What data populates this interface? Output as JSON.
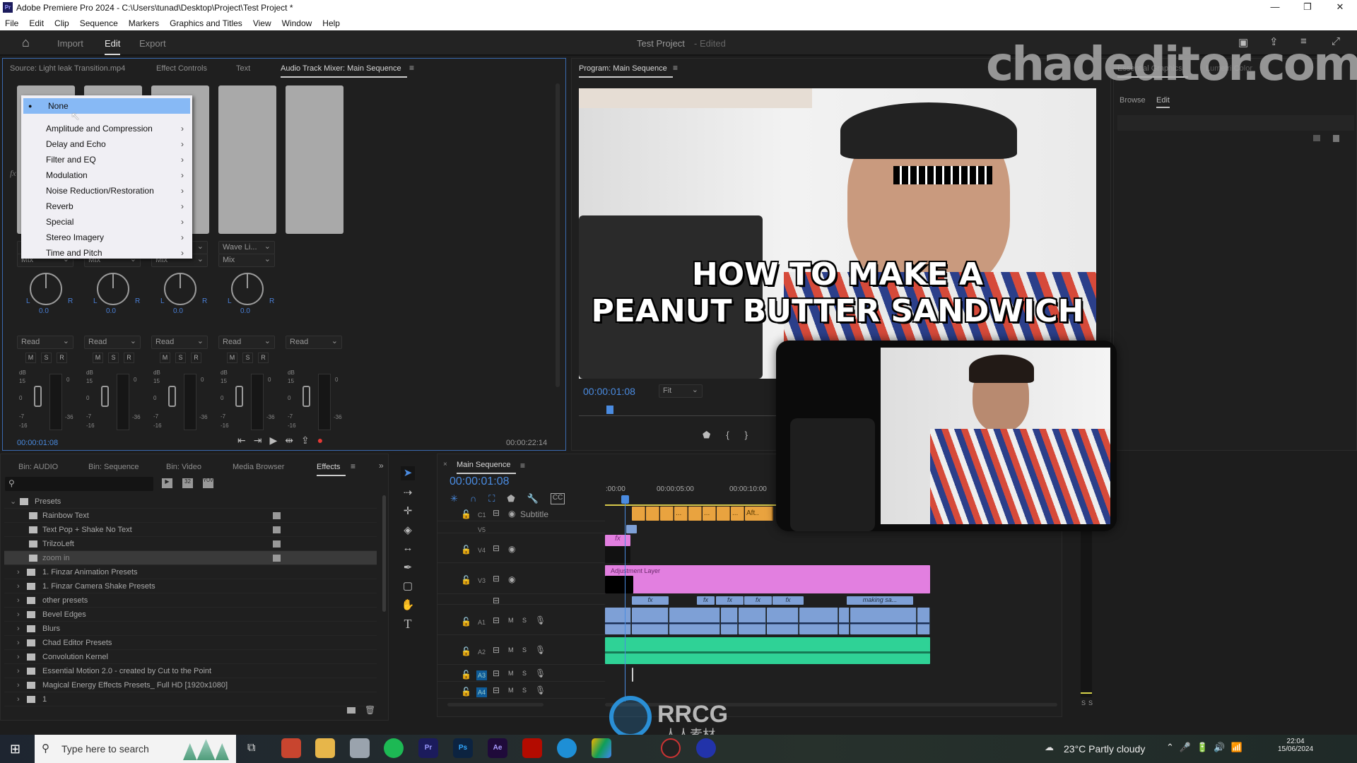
{
  "window": {
    "title": "Adobe Premiere Pro 2024 - C:\\Users\\tunad\\Desktop\\Project\\Test Project *",
    "app_icon": "Pr"
  },
  "menubar": [
    "File",
    "Edit",
    "Clip",
    "Sequence",
    "Markers",
    "Graphics and Titles",
    "View",
    "Window",
    "Help"
  ],
  "header": {
    "nav": [
      "Import",
      "Edit",
      "Export"
    ],
    "active": "Edit",
    "project": "Test Project",
    "status": "- Edited"
  },
  "source_panel": {
    "tabs": [
      "Source: Light leak Transition.mp4",
      "Effect Controls",
      "Text",
      "Audio Track Mixer: Main Sequence"
    ],
    "active_tab": "Audio Track Mixer: Main Sequence",
    "channels": [
      {
        "effect": "",
        "send": "Mix",
        "pan": "0.0",
        "mode": "Read"
      },
      {
        "effect": "",
        "send": "Mix",
        "pan": "0.0",
        "mode": "Read"
      },
      {
        "effect": "",
        "send": "Mix",
        "pan": "0.0",
        "mode": "Read"
      },
      {
        "effect": "Wave Li...",
        "send": "Mix",
        "pan": "0.0",
        "mode": "Read"
      },
      {
        "mode": "Read"
      }
    ],
    "msr": [
      "M",
      "S",
      "R"
    ],
    "pan_l": "L",
    "pan_r": "R",
    "db_scale": [
      "dB",
      "15",
      "0",
      "-7",
      "-16"
    ],
    "meter_scale": [
      "0",
      "-36"
    ],
    "timecode_left": "00:00:01:08",
    "timecode_right": "00:00:22:14"
  },
  "effect_menu": {
    "items": [
      {
        "label": "None",
        "selected": true
      },
      {
        "label": "Amplitude and Compression",
        "submenu": true
      },
      {
        "label": "Delay and Echo",
        "submenu": true
      },
      {
        "label": "Filter and EQ",
        "submenu": true
      },
      {
        "label": "Modulation",
        "submenu": true
      },
      {
        "label": "Noise Reduction/Restoration",
        "submenu": true
      },
      {
        "label": "Reverb",
        "submenu": true
      },
      {
        "label": "Special",
        "submenu": true
      },
      {
        "label": "Stereo Imagery",
        "submenu": true
      },
      {
        "label": "Time and Pitch",
        "submenu": true
      }
    ]
  },
  "program": {
    "title": "Program: Main Sequence",
    "timecode": "00:00:01:08",
    "zoom": "Fit",
    "overlay_line1": "HOW TO MAKE A",
    "overlay_line2": "PEANUT BUTTER SANDWICH"
  },
  "right_panel": {
    "tabs": [
      "Essential Graphics",
      "Lumetri Color"
    ],
    "subtabs": [
      "Browse",
      "Edit"
    ],
    "active_subtab": "Edit"
  },
  "watermark": "chadeditor.com",
  "project_panel": {
    "tabs": [
      "Bin: AUDIO",
      "Bin: Sequence",
      "Bin: Video",
      "Media Browser",
      "Effects"
    ],
    "active_tab": "Effects",
    "search_placeholder": "",
    "badges": [
      "32",
      "YUV"
    ],
    "tree": [
      {
        "label": "Presets",
        "expanded": true,
        "level": 0
      },
      {
        "label": "Rainbow Text",
        "level": 1
      },
      {
        "label": "Text Pop + Shake No Text",
        "level": 1
      },
      {
        "label": "TrilzoLeft",
        "level": 1
      },
      {
        "label": "zoom in",
        "level": 1,
        "selected": true
      },
      {
        "label": "1. Finzar Animation Presets",
        "level": 0
      },
      {
        "label": "1. Finzar Camera Shake Presets",
        "level": 0
      },
      {
        "label": "other presets",
        "level": 0
      },
      {
        "label": "Bevel Edges",
        "level": 0
      },
      {
        "label": "Blurs",
        "level": 0
      },
      {
        "label": "Chad Editor Presets",
        "level": 0
      },
      {
        "label": "Convolution Kernel",
        "level": 0
      },
      {
        "label": "Essential Motion 2.0 - created by Cut to the Point",
        "level": 0
      },
      {
        "label": "Magical Energy Effects Presets_ Full HD [1920x1080]",
        "level": 0
      },
      {
        "label": "1",
        "level": 0
      }
    ]
  },
  "timeline": {
    "title": "Main Sequence",
    "timecode": "00:00:01:08",
    "ruler": [
      ":00:00",
      "00:00:05:00",
      "00:00:10:00"
    ],
    "tracks": [
      {
        "id": "C1",
        "name": "Subtitle"
      },
      {
        "id": "V5"
      },
      {
        "id": "V4"
      },
      {
        "id": "V3"
      },
      {
        "id": "A1",
        "m": "M",
        "s": "S"
      },
      {
        "id": "A2",
        "m": "M",
        "s": "S"
      },
      {
        "id": "A3",
        "m": "M",
        "s": "S"
      },
      {
        "id": "A4",
        "m": "M",
        "s": "S"
      }
    ],
    "clips": {
      "subtitle": "Aft...",
      "ellipsis": "...",
      "adjustment": "Adjustment Layer",
      "v2": "making sa...",
      "fx": "fx"
    },
    "colors": {
      "subtitle": "#e9a33f",
      "video": "#7ea0d6",
      "adjustment": "#e27fe0",
      "audio1": "#7ea0d6",
      "audio2": "#2fd296",
      "playhead": "#4a8be0"
    }
  },
  "meters": {
    "solo": [
      "S",
      "S"
    ]
  },
  "logo": {
    "text": "RRCG",
    "sub": "人人素材"
  },
  "taskbar": {
    "search_placeholder": "Type here to search",
    "weather": "23°C  Partly cloudy",
    "time": "22:04",
    "date": "15/06/2024",
    "apps": [
      "Pr",
      "Ps",
      "Ae"
    ]
  },
  "accent": "#4a8be0"
}
